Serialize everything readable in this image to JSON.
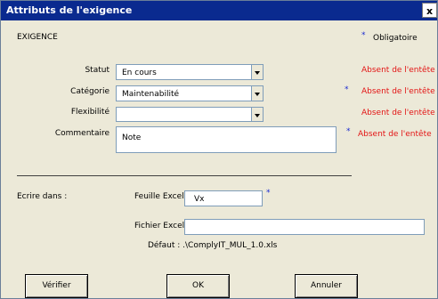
{
  "window": {
    "title": "Attributs de l'exigence",
    "close_label": "x"
  },
  "header": {
    "section_label": "EXIGENCE",
    "required_star": "*",
    "required_label": "Obligatoire"
  },
  "form": {
    "statut": {
      "label": "Statut",
      "value": "En cours",
      "warning": "Absent de l'entête"
    },
    "categorie": {
      "label": "Catégorie",
      "value": "Maintenabilité",
      "required_star": "*",
      "warning": "Absent de l'entête"
    },
    "flexibilite": {
      "label": "Flexibilité",
      "value": "",
      "warning": "Absent de l'entête"
    },
    "commentaire": {
      "label": "Commentaire",
      "value": "Note",
      "required_star": "*",
      "warning": "Absent de l'entête"
    }
  },
  "write": {
    "label": "Ecrire dans :",
    "sheet_label": "Feuille Excel",
    "sheet_value": "Vx",
    "sheet_required_star": "*",
    "file_label": "Fichier Excel",
    "file_value": "",
    "default_text": "Défaut : .\\ComplyIT_MUL_1.0.xls"
  },
  "buttons": {
    "verify": "Vérifier",
    "ok": "OK",
    "cancel": "Annuler"
  },
  "colors": {
    "title_bar": "#0a2a8f",
    "warning": "#e31515",
    "required_star": "#1a2ad1",
    "dialog_bg": "#ece9d8"
  }
}
